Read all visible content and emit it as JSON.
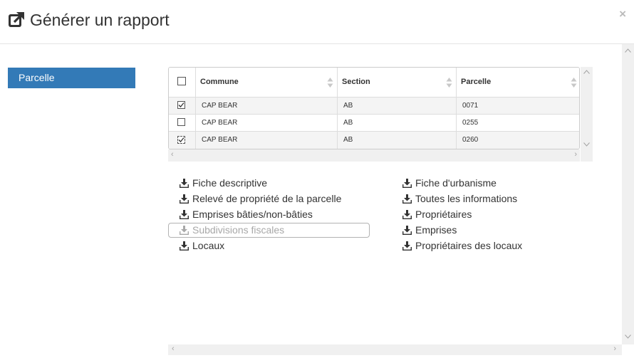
{
  "dialog": {
    "title": "Générer un rapport",
    "title_icon": "external-link-square-icon",
    "close_label": "×"
  },
  "sidebar": {
    "tabs": [
      {
        "label": "Parcelle",
        "active": true
      }
    ]
  },
  "table": {
    "columns": [
      "Commune",
      "Section",
      "Parcelle"
    ],
    "rows": [
      {
        "checked": true,
        "commune": "CAP BEAR",
        "section": "AB",
        "parcelle": "0071"
      },
      {
        "checked": false,
        "commune": "CAP BEAR",
        "section": "AB",
        "parcelle": "0255"
      },
      {
        "checked": true,
        "commune": "CAP BEAR",
        "section": "AB",
        "parcelle": "0260"
      }
    ]
  },
  "reports": {
    "left": [
      {
        "label": "Fiche descriptive",
        "enabled": true
      },
      {
        "label": "Relevé de propriété de la parcelle",
        "enabled": true
      },
      {
        "label": "Emprises bâties/non-bâties",
        "enabled": true
      },
      {
        "label": "Subdivisions fiscales",
        "enabled": false
      },
      {
        "label": "Locaux",
        "enabled": true
      }
    ],
    "right": [
      {
        "label": "Fiche d'urbanisme",
        "enabled": true
      },
      {
        "label": "Toutes les informations",
        "enabled": true
      },
      {
        "label": "Propriétaires",
        "enabled": true
      },
      {
        "label": "Emprises",
        "enabled": true
      },
      {
        "label": "Propriétaires des locaux",
        "enabled": true
      }
    ],
    "icon": "download-icon"
  },
  "colors": {
    "accent": "#337ab7",
    "disabled_text": "#a8a8a8",
    "row_alt": "#f4f4f4"
  }
}
